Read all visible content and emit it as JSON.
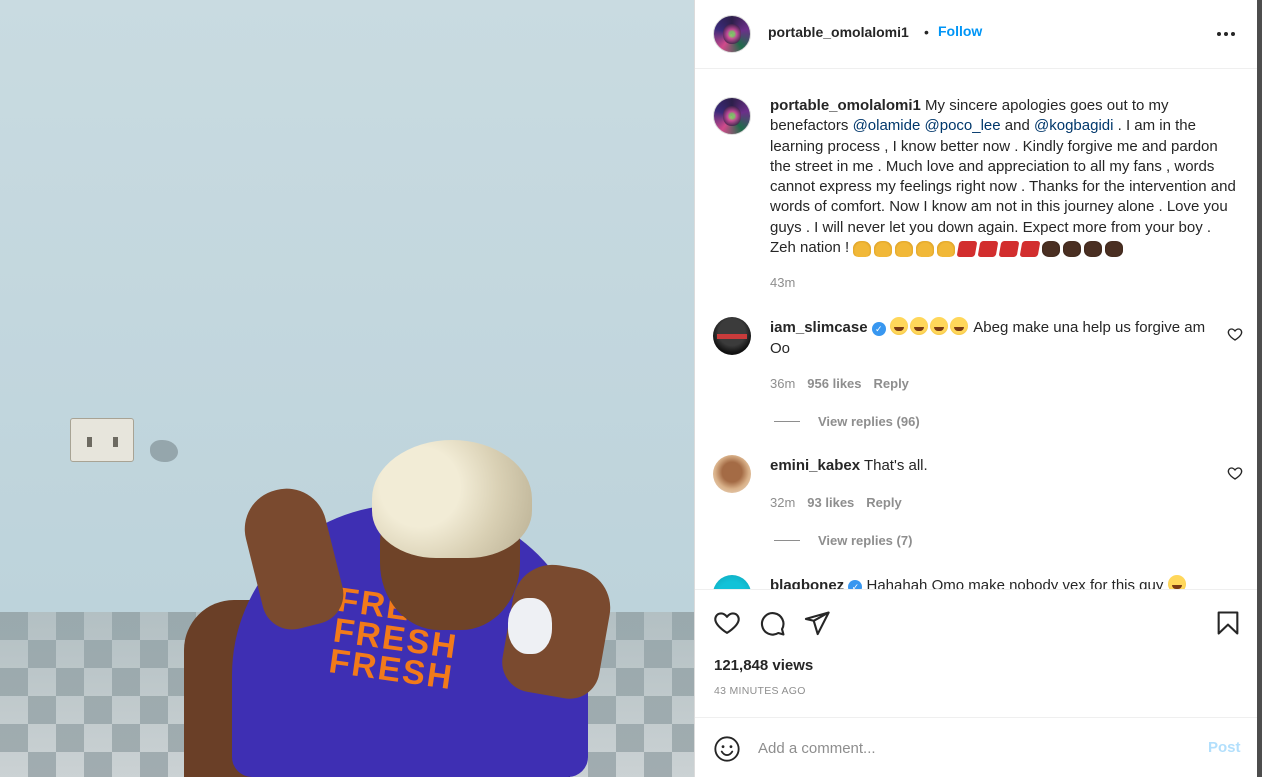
{
  "post": {
    "username": "portable_omolalomi1",
    "follow_label": "Follow",
    "separator": "•"
  },
  "caption": {
    "username": "portable_omolalomi1",
    "text_1": " My sincere apologies goes out to my benefactors ",
    "mention_1": "@olamide",
    "mention_2": "@poco_lee",
    "text_2": " and ",
    "mention_3": "@kogbagidi",
    "text_3": " . I am in the learning process , I know better now . Kindly forgive me and pardon the street in me . Much love and appreciation to all my fans , words cannot express my feelings right now . Thanks for the intervention and words of comfort. Now I know am not in this journey alone . Love you guys . I will never let you down again. Expect more from your boy . Zeh nation ! ",
    "time": "43m"
  },
  "comments": [
    {
      "username": "iam_slimcase",
      "verified": true,
      "text": " Abeg make una help us forgive am Oo",
      "time": "36m",
      "likes": "956 likes",
      "reply": "Reply",
      "view_replies": "View replies (96)"
    },
    {
      "username": "emini_kabex",
      "verified": false,
      "text": " That's all.",
      "time": "32m",
      "likes": "93 likes",
      "reply": "Reply",
      "view_replies": "View replies (7)"
    },
    {
      "username": "blaqbonez",
      "verified": true,
      "text": " Hahahah Omo make nobody vex for this guy "
    }
  ],
  "stats": {
    "views": "121,848 views",
    "posted": "43 MINUTES AGO"
  },
  "comment_box": {
    "placeholder": "Add a comment...",
    "post_label": "Post"
  },
  "media": {
    "shirt_print": "FRESH FRESH FRESH"
  },
  "colors": {
    "accent": "#0095f6",
    "mention": "#00376b",
    "muted": "#8e8e8e",
    "post_disabled": "#b2dffc"
  }
}
